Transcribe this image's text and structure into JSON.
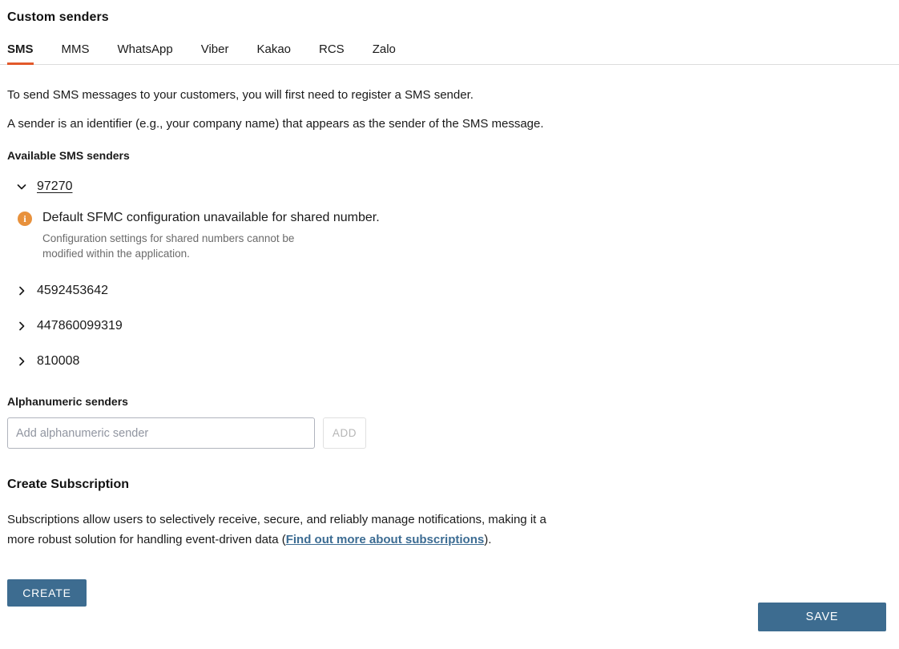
{
  "page": {
    "title": "Custom senders"
  },
  "tabs": {
    "active": "SMS",
    "items": [
      {
        "label": "SMS"
      },
      {
        "label": "MMS"
      },
      {
        "label": "WhatsApp"
      },
      {
        "label": "Viber"
      },
      {
        "label": "Kakao"
      },
      {
        "label": "RCS"
      },
      {
        "label": "Zalo"
      }
    ]
  },
  "intro": {
    "line1": "To send SMS messages to your customers, you will first need to register a SMS sender.",
    "line2": "A sender is an identifier (e.g., your company name) that appears as the sender of the SMS message."
  },
  "available_senders": {
    "label": "Available SMS senders",
    "items": [
      {
        "name": "97270",
        "expanded": true,
        "chevron": "chevron-down-icon"
      },
      {
        "name": "4592453642",
        "expanded": false,
        "chevron": "chevron-right-icon"
      },
      {
        "name": "447860099319",
        "expanded": false,
        "chevron": "chevron-right-icon"
      },
      {
        "name": "810008",
        "expanded": false,
        "chevron": "chevron-right-icon"
      }
    ]
  },
  "info_message": {
    "icon": "info-circle-icon",
    "icon_glyph": "i",
    "icon_color": "#e8913c",
    "title": "Default SFMC configuration unavailable for shared number.",
    "description": "Configuration settings for shared numbers cannot be modified within the application."
  },
  "alphanumeric": {
    "label": "Alphanumeric senders",
    "input_value": "",
    "input_placeholder": "Add alphanumeric sender",
    "add_label": "ADD"
  },
  "subscription": {
    "title": "Create Subscription",
    "text_before": "Subscriptions allow users to selectively receive, secure, and reliably manage notifications, making it a more robust solution for handling event-driven data (",
    "link_label": "Find out more about subscriptions",
    "text_after": ").",
    "create_label": "CREATE"
  },
  "footer": {
    "save_label": "SAVE"
  },
  "colors": {
    "accent_orange": "#e2592b",
    "info_orange": "#e8913c",
    "primary_blue": "#3d6c90",
    "link_blue": "#3c6c93"
  }
}
